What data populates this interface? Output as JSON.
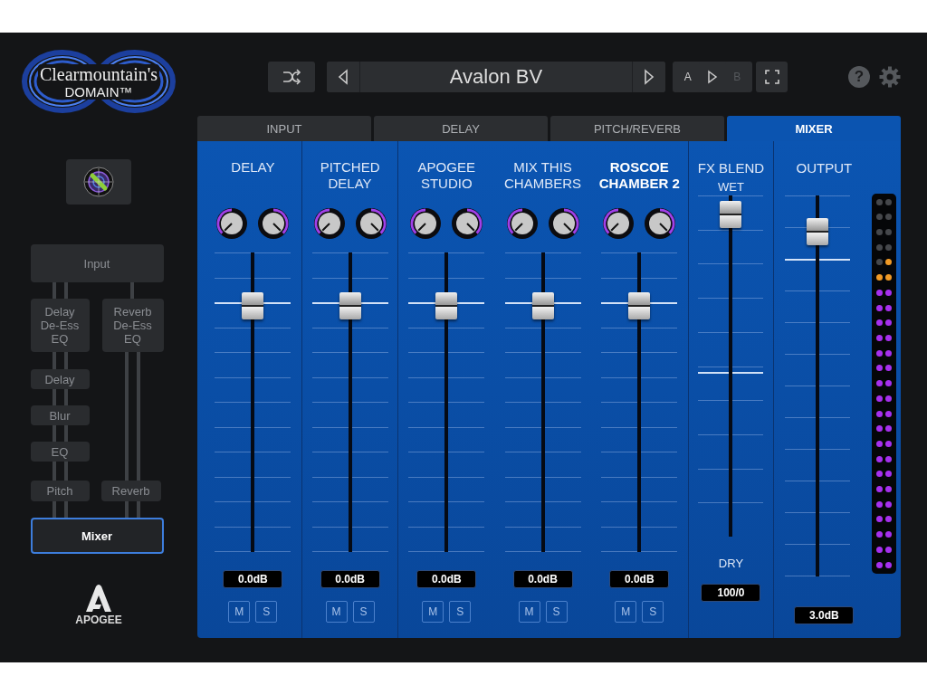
{
  "logo": {
    "title": "Clearmountain's",
    "subtitle": "DOMAIN™"
  },
  "signal_flow": {
    "nodes": [
      {
        "label": "Input",
        "selected": false
      },
      {
        "label": "Delay De-Ess EQ",
        "selected": false
      },
      {
        "label": "Reverb De-Ess EQ",
        "selected": false
      },
      {
        "label": "Delay",
        "selected": false
      },
      {
        "label": "Blur",
        "selected": false
      },
      {
        "label": "EQ",
        "selected": false
      },
      {
        "label": "Pitch",
        "selected": false
      },
      {
        "label": "Reverb",
        "selected": false
      },
      {
        "label": "Mixer",
        "selected": true
      }
    ]
  },
  "brand": "APOGEE",
  "toolbar": {
    "preset": "Avalon BV",
    "ab": [
      {
        "label": "A",
        "disabled": false
      },
      {
        "label": "B",
        "disabled": true
      }
    ],
    "help": "?"
  },
  "tabs": [
    {
      "label": "INPUT",
      "selected": false
    },
    {
      "label": "DELAY",
      "selected": false
    },
    {
      "label": "PITCH/REVERB",
      "selected": false
    },
    {
      "label": "MIXER",
      "selected": true
    }
  ],
  "channels": [
    {
      "name": "DELAY",
      "selected": false,
      "knobs": [
        {
          "pan_right": false
        },
        {
          "pan_right": true
        }
      ],
      "level": 0.87,
      "reading": "0.0dB",
      "mute": "M",
      "solo": "S"
    },
    {
      "name": "PITCHED DELAY",
      "selected": false,
      "knobs": [
        {
          "pan_right": false
        },
        {
          "pan_right": true
        }
      ],
      "level": 0.87,
      "reading": "0.0dB",
      "mute": "M",
      "solo": "S"
    },
    {
      "name": "APOGEE STUDIO",
      "selected": false,
      "knobs": [
        {
          "pan_right": false
        },
        {
          "pan_right": true
        }
      ],
      "level": 0.87,
      "reading": "0.0dB",
      "mute": "M",
      "solo": "S"
    },
    {
      "name": "MIX THIS CHAMBERS",
      "selected": false,
      "knobs": [
        {
          "pan_right": false
        },
        {
          "pan_right": true
        }
      ],
      "level": 0.87,
      "reading": "0.0dB",
      "mute": "M",
      "solo": "S"
    },
    {
      "name": "ROSCOE CHAMBER 2",
      "selected": true,
      "knobs": [
        {
          "pan_right": false
        },
        {
          "pan_right": true
        }
      ],
      "level": 0.87,
      "reading": "0.0dB",
      "mute": "M",
      "solo": "S"
    }
  ],
  "fx_blend": {
    "name": "FX BLEND",
    "top_label": "WET",
    "bottom_label": "DRY",
    "level": 1,
    "reading": "100/0"
  },
  "output": {
    "name": "OUTPUT",
    "level": 0.95,
    "reading": "3.0dB",
    "meter": [
      {
        "level": 0.8
      },
      {
        "level": 0.84
      }
    ]
  }
}
